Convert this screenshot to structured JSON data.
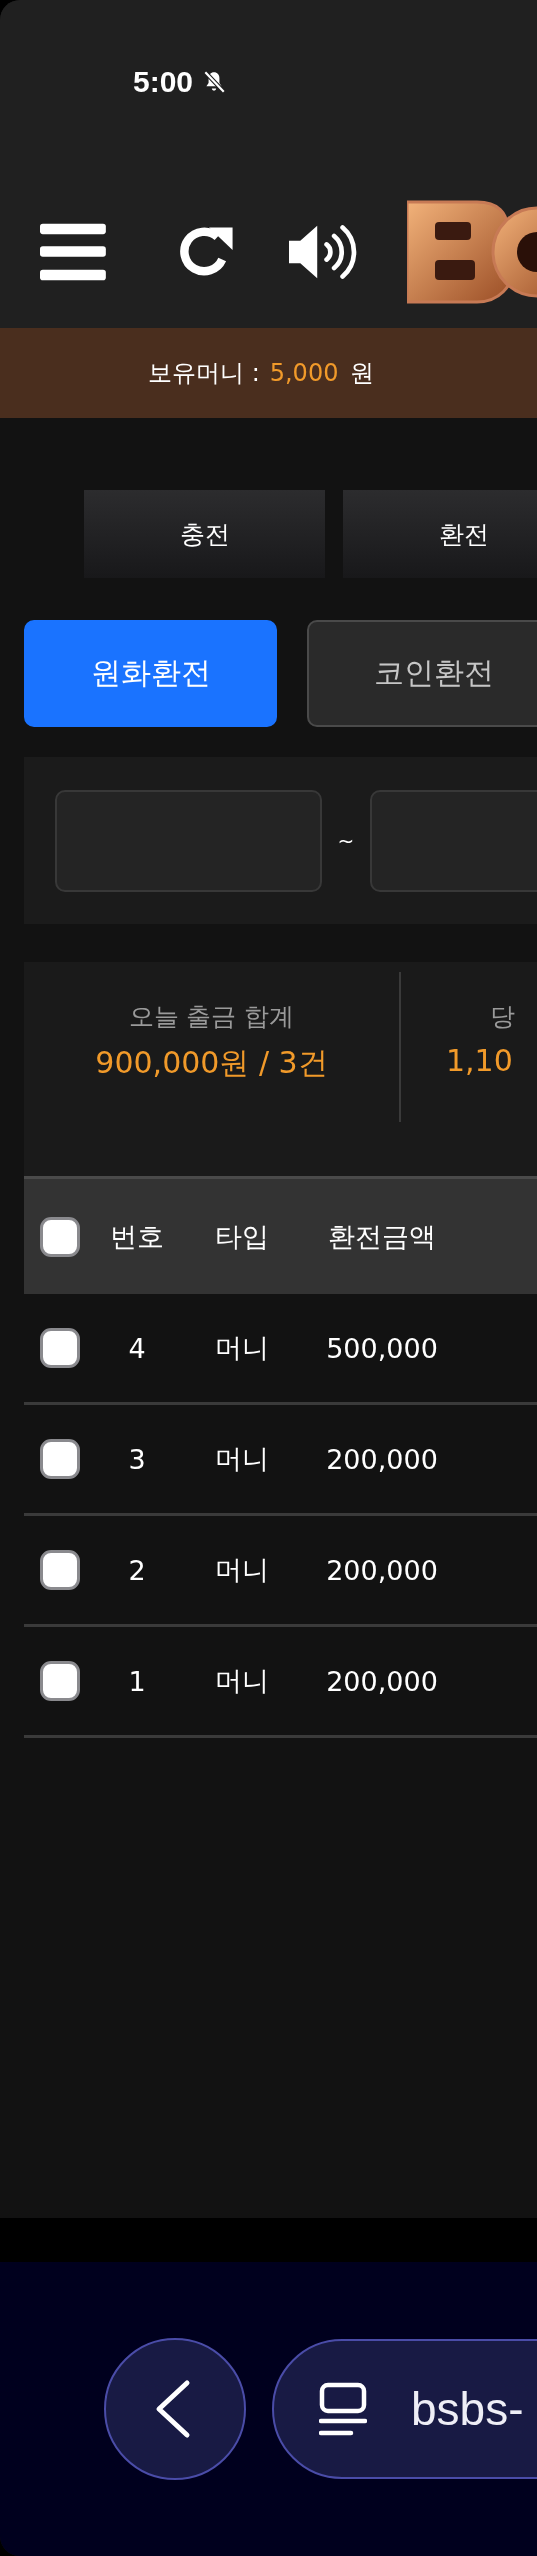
{
  "status_bar": {
    "time": "5:00"
  },
  "balance": {
    "label": "보유머니 :",
    "amount": "5,000",
    "unit": "원"
  },
  "main_tabs": [
    {
      "label": "충전"
    },
    {
      "label": "환전"
    }
  ],
  "sub_tabs": [
    {
      "label": "원화환전",
      "selected": true
    },
    {
      "label": "코인환전",
      "selected": false
    }
  ],
  "filter": {
    "separator": "~"
  },
  "summary": [
    {
      "label": "오늘 출금 합계",
      "value": "900,000원 / 3건"
    },
    {
      "label": "당",
      "value": "1,10"
    }
  ],
  "table": {
    "header_checked": false,
    "columns": [
      "번호",
      "타입",
      "환전금액"
    ],
    "rows": [
      {
        "checked": false,
        "cells": [
          "4",
          "머니",
          "500,000"
        ]
      },
      {
        "checked": false,
        "cells": [
          "3",
          "머니",
          "200,000"
        ]
      },
      {
        "checked": false,
        "cells": [
          "2",
          "머니",
          "200,000"
        ]
      },
      {
        "checked": false,
        "cells": [
          "1",
          "머니",
          "200,000"
        ]
      }
    ]
  },
  "browser": {
    "url": "bsbs-"
  }
}
